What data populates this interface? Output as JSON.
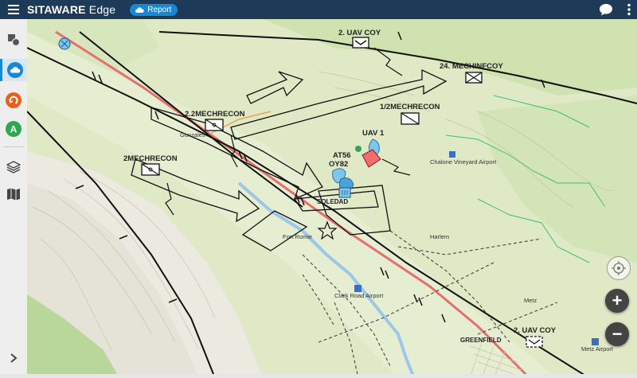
{
  "header": {
    "title_bold": "SITAWARE",
    "title_light": " Edge",
    "report_label": "Report",
    "accent_color": "#1d3a58",
    "report_color": "#1787d8"
  },
  "sidebar": {
    "items": [
      {
        "icon": "shapes-icon"
      },
      {
        "icon": "cloud-icon",
        "active": true
      },
      {
        "icon": "orange-refresh-icon",
        "color": "#e8601c"
      },
      {
        "icon": "green-a-icon",
        "label": "A",
        "color": "#2fa84f"
      },
      {
        "icon": "layers-icon"
      },
      {
        "icon": "map-book-icon"
      }
    ],
    "expand_icon": "chevron-right-icon"
  },
  "map": {
    "units": [
      {
        "label": "2. UAV COY"
      },
      {
        "label": "24. MECHINFCOY"
      },
      {
        "label": "2.2MECHRECON"
      },
      {
        "label": "1/2MECHRECON"
      },
      {
        "label": "2MECHRECON"
      },
      {
        "label": "UAV 1"
      },
      {
        "label": "AT56"
      },
      {
        "label": "OY82"
      },
      {
        "label": "2. UAV COY"
      }
    ],
    "places": [
      {
        "label": "SOLEDAD"
      },
      {
        "label": "Fort Romie"
      },
      {
        "label": "Harlem"
      },
      {
        "label": "Metz"
      },
      {
        "label": "GREENFIELD"
      },
      {
        "label": "Clark Road Airport"
      },
      {
        "label": "Metz Airport"
      },
      {
        "label": "Chalone Vineyard Airport"
      },
      {
        "label": "Gonzales"
      }
    ]
  },
  "controls": {
    "zoom_in": "+",
    "zoom_out": "−",
    "compass_icon": "compass-icon"
  }
}
